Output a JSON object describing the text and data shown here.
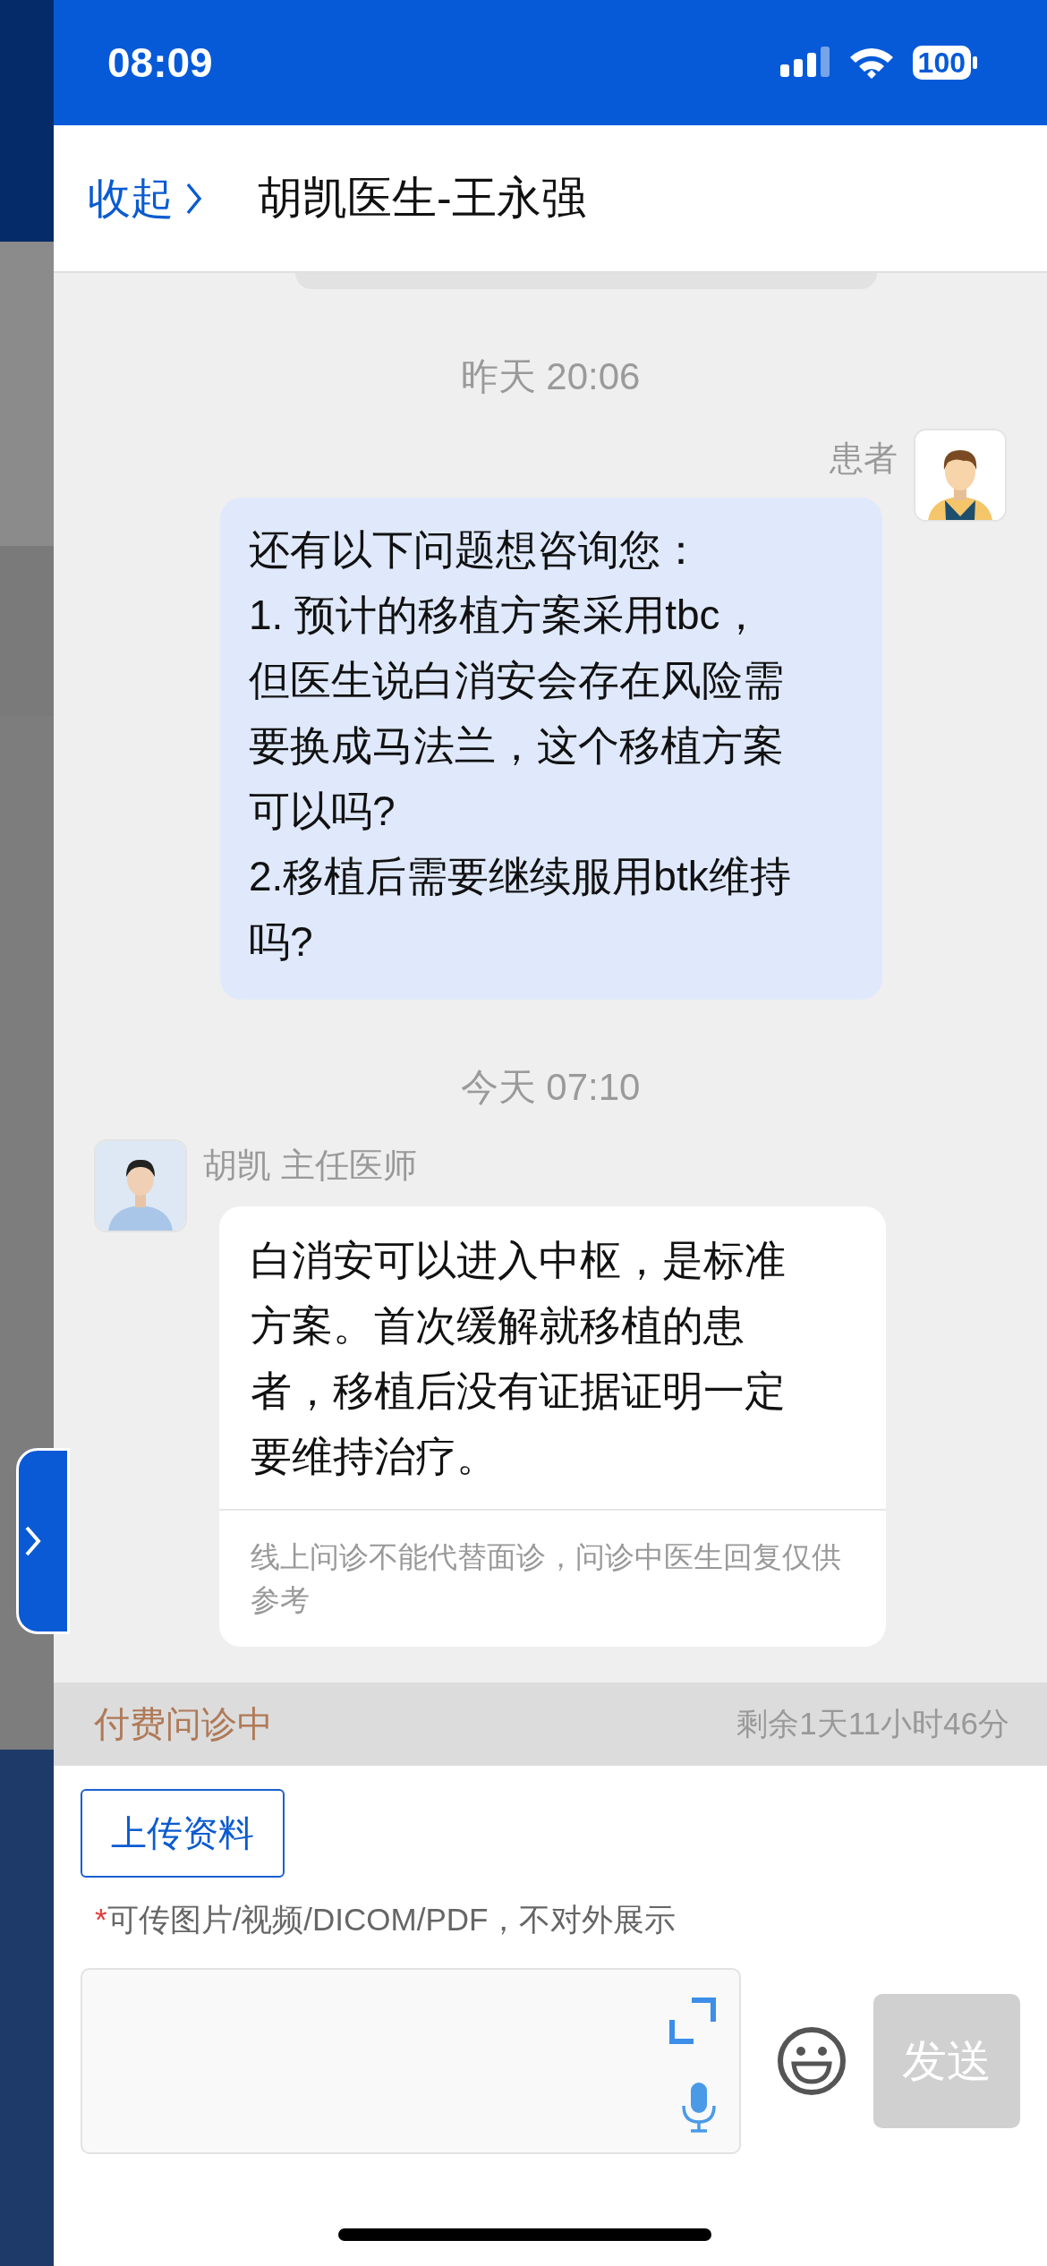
{
  "status_bar": {
    "time": "08:09",
    "battery": "100"
  },
  "header": {
    "collapse": "收起",
    "title": "胡凯医生-王永强"
  },
  "messages": [
    {
      "kind": "time",
      "text": "昨天 20:06"
    },
    {
      "kind": "patient",
      "sender": "患者",
      "lines": [
        "还有以下问题想咨询您：",
        "1. 预计的移植方案采用tbc，",
        "但医生说白消安会存在风险需",
        "要换成马法兰，这个移植方案",
        "可以吗?",
        "2.移植后需要继续服用btk维持",
        "吗?"
      ]
    },
    {
      "kind": "time",
      "text": "今天 07:10"
    },
    {
      "kind": "doctor",
      "sender": "胡凯 主任医师",
      "lines": [
        "白消安可以进入中枢，是标准",
        "方案。首次缓解就移植的患",
        "者，移植后没有证据证明一定",
        "要维持治疗。"
      ],
      "disclaimer": "线上问诊不能代替面诊，问诊中医生回复仅供参考"
    }
  ],
  "consult_status": {
    "label": "付费问诊中",
    "remaining": "剩余1天11小时46分"
  },
  "composer": {
    "upload": "上传资料",
    "note_mark": "*",
    "note": "可传图片/视频/DICOM/PDF，不对外展示",
    "send": "发送",
    "send_disabled": true
  }
}
